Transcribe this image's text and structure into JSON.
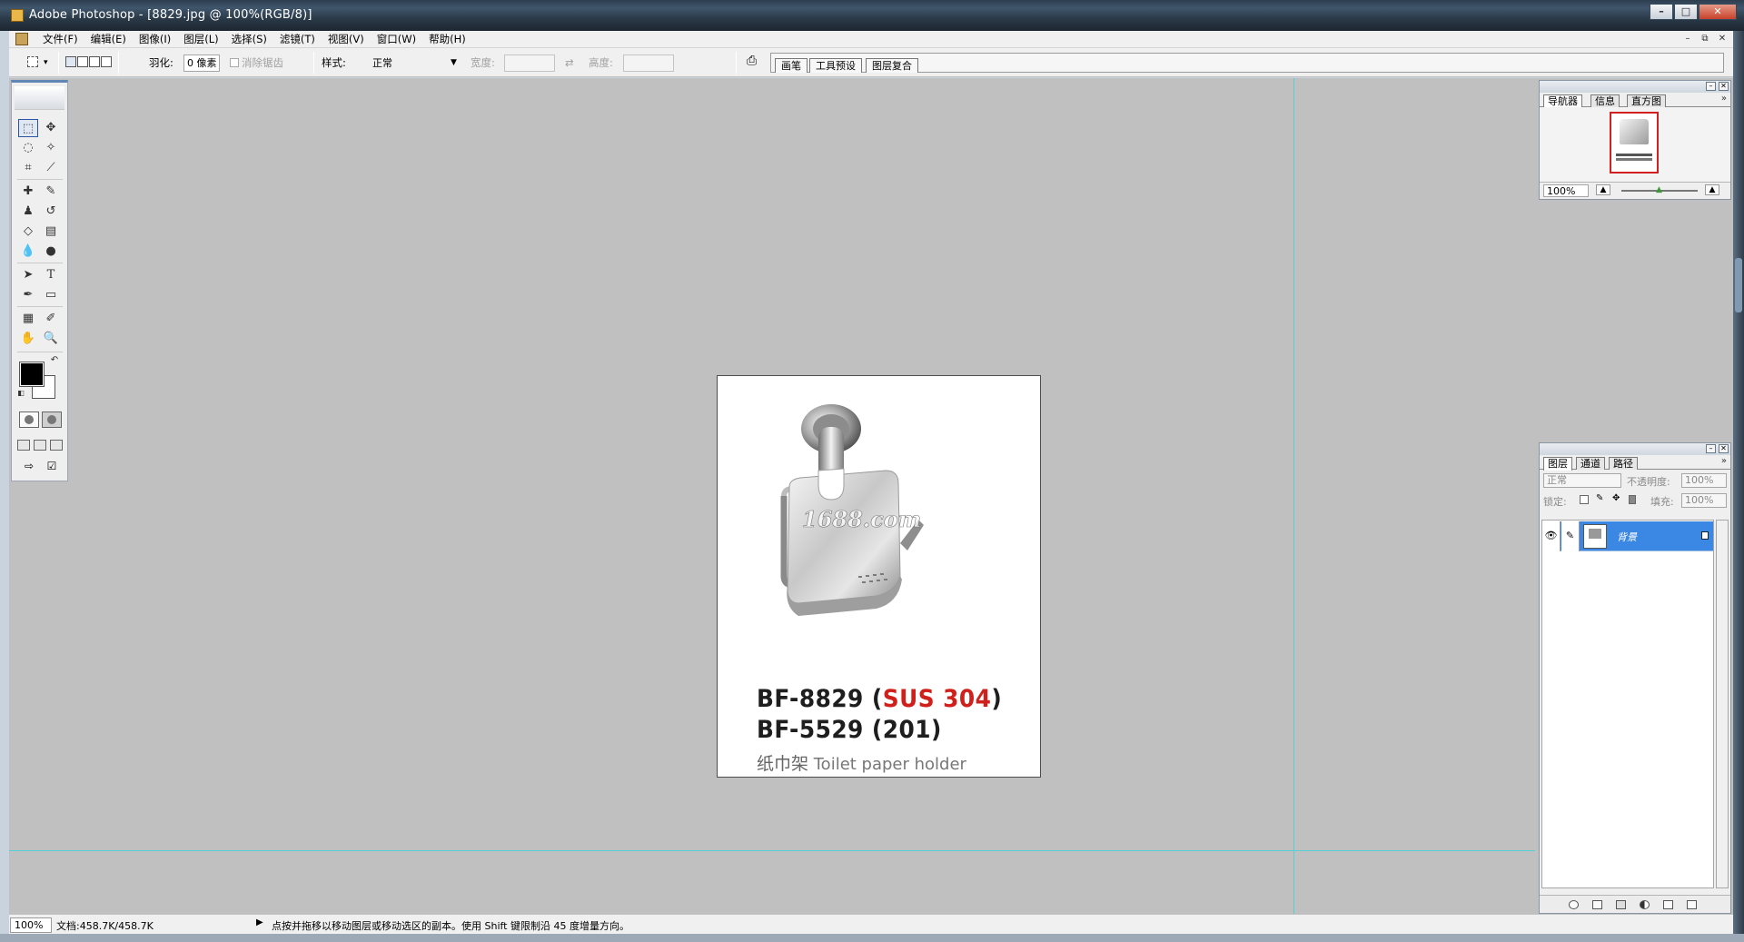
{
  "window": {
    "title": "Adobe Photoshop - [8829.jpg @ 100%(RGB/8)]",
    "controls": {
      "minimize": "–",
      "maximize": "□",
      "close": "✕"
    }
  },
  "menu": {
    "items": [
      "文件(F)",
      "编辑(E)",
      "图像(I)",
      "图层(L)",
      "选择(S)",
      "滤镜(T)",
      "视图(V)",
      "窗口(W)",
      "帮助(H)"
    ],
    "doc_controls": [
      "–",
      "⧉",
      "✕"
    ]
  },
  "options": {
    "feather_label": "羽化:",
    "feather_value": "0 像素",
    "antialias_label": "消除锯齿",
    "style_label": "样式:",
    "style_value": "正常",
    "width_label": "宽度:",
    "swap_icon": "⇄",
    "height_label": "高度:",
    "well_tabs": [
      "画笔",
      "工具预设",
      "图层复合"
    ]
  },
  "document": {
    "model_line1_prefix": "BF-8829 (",
    "model_line1_highlight": "SUS 304",
    "model_line1_suffix": ")",
    "model_line2": "BF-5529 (201)",
    "caption_cn": "纸巾架",
    "caption_en": "Toilet paper holder",
    "watermark": "1688.com",
    "accent_color": "#d0201c"
  },
  "toolbox": {
    "tools": [
      "rectangular-marquee",
      "move",
      "lasso",
      "magic-wand",
      "crop",
      "slice",
      "healing-brush",
      "brush",
      "clone-stamp",
      "history-brush",
      "eraser",
      "gradient",
      "blur",
      "dodge",
      "path-selection",
      "type",
      "pen",
      "rectangle",
      "notes",
      "eyedropper",
      "hand",
      "zoom"
    ],
    "foreground_color": "#000000",
    "background_color": "#ffffff"
  },
  "navigator": {
    "tabs": [
      "导航器",
      "信息",
      "直方图"
    ],
    "zoom": "100%"
  },
  "layers": {
    "tabs": [
      "图层",
      "通道",
      "路径"
    ],
    "blend_mode": "正常",
    "opacity_label": "不透明度:",
    "opacity_value": "100%",
    "lock_label": "锁定:",
    "fill_label": "填充:",
    "fill_value": "100%",
    "layer_name": "背景"
  },
  "status": {
    "zoom": "100%",
    "doc_size": "文档:458.7K/458.7K",
    "hint": "点按并拖移以移动图层或移动选区的副本。使用 Shift 键限制沿 45 度增量方向。"
  }
}
